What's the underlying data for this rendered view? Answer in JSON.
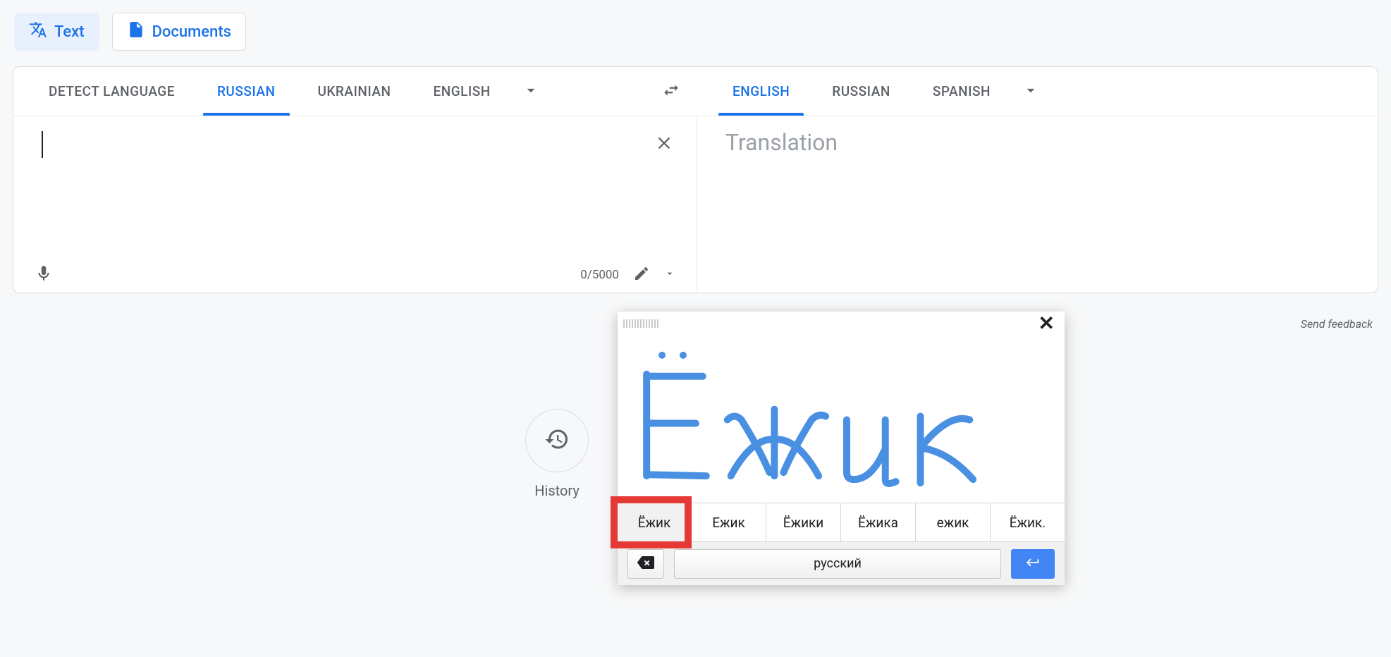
{
  "modes": {
    "text": "Text",
    "documents": "Documents"
  },
  "source_langs": {
    "detect": "DETECT LANGUAGE",
    "items": [
      "RUSSIAN",
      "UKRAINIAN",
      "ENGLISH"
    ],
    "active_index": 0
  },
  "target_langs": {
    "items": [
      "ENGLISH",
      "RUSSIAN",
      "SPANISH"
    ],
    "active_index": 0
  },
  "input": {
    "value": "",
    "counter": "0/5000"
  },
  "output": {
    "placeholder": "Translation"
  },
  "feedback": "Send feedback",
  "history_label": "History",
  "handwriting": {
    "suggestions": [
      "Ёжик",
      "Ежик",
      "Ёжики",
      "Ёжика",
      "ежик",
      "Ёжик."
    ],
    "highlighted_index": 0,
    "lang_button": "русский"
  }
}
